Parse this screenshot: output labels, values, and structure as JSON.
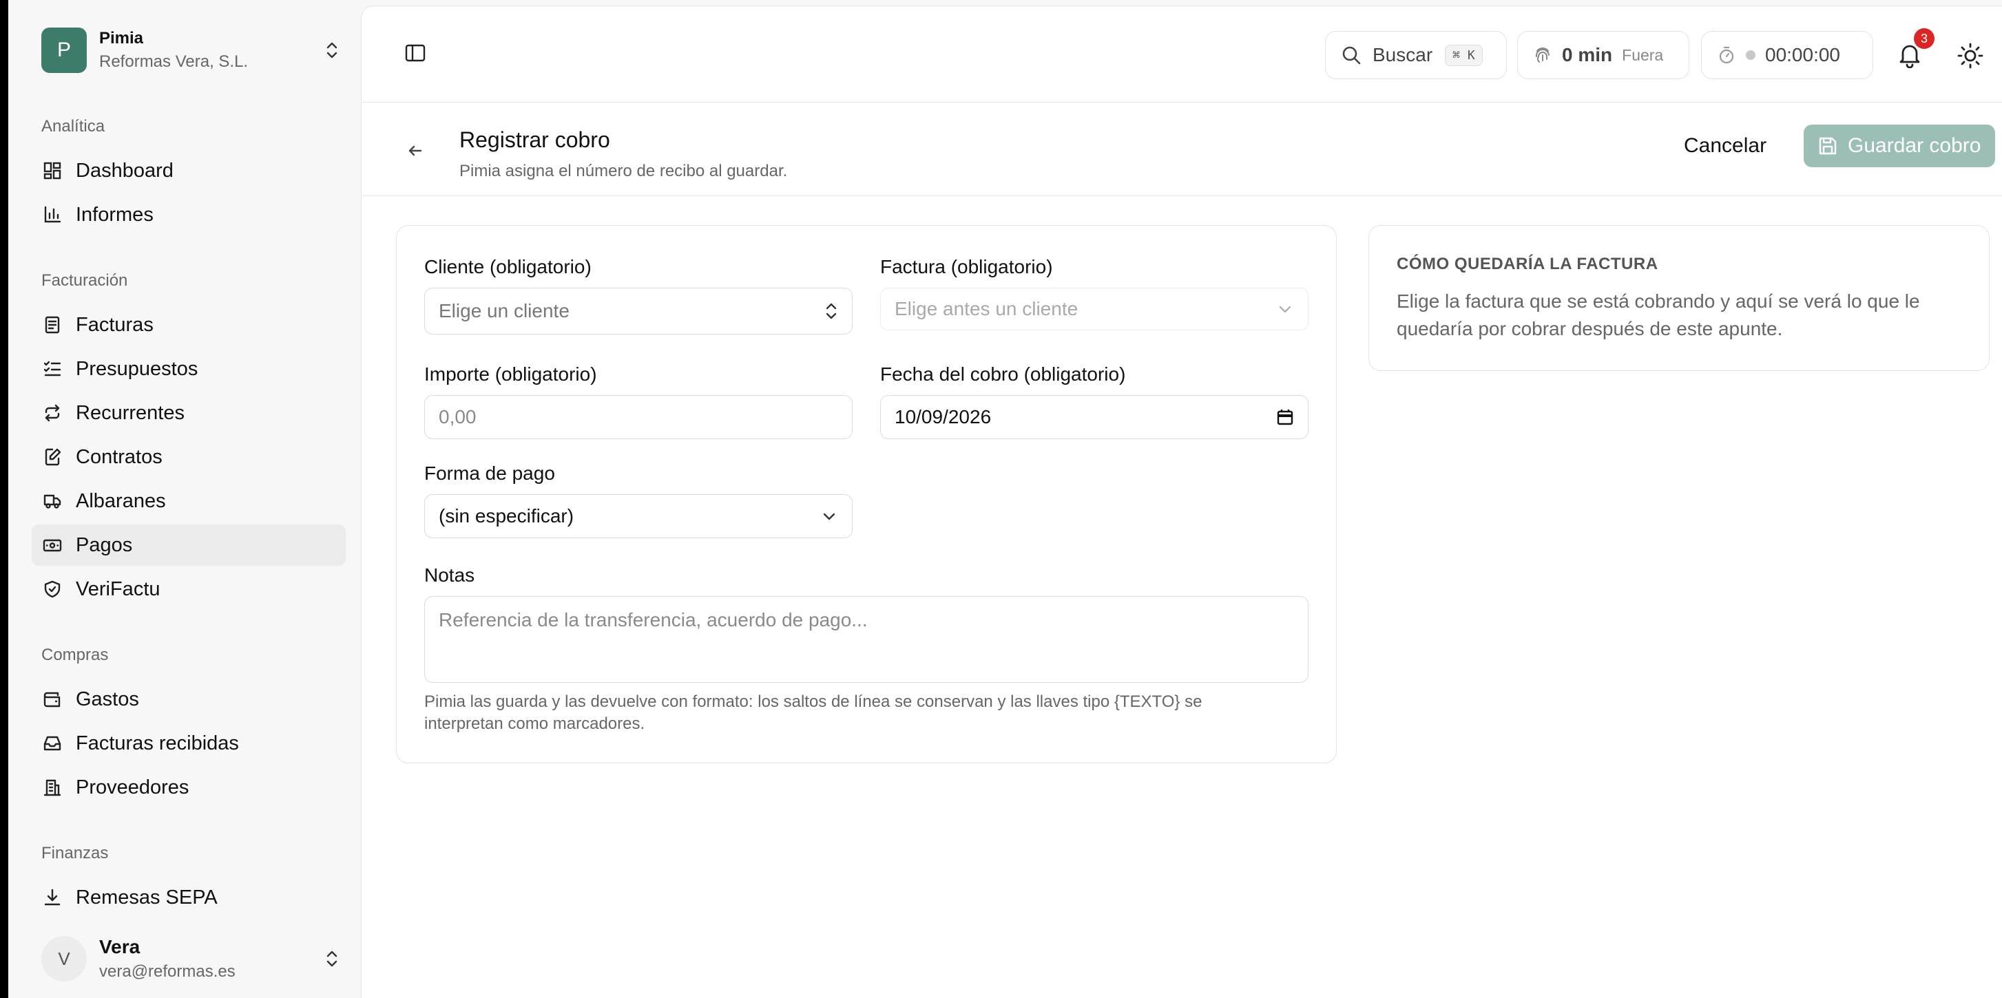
{
  "workspace": {
    "logo_letter": "P",
    "name": "Pimia",
    "company": "Reformas Vera, S.L."
  },
  "sidebar": {
    "sections": [
      {
        "label": "Analítica",
        "items": [
          {
            "label": "Dashboard",
            "icon": "dashboard-icon"
          },
          {
            "label": "Informes",
            "icon": "chart-icon"
          }
        ]
      },
      {
        "label": "Facturación",
        "items": [
          {
            "label": "Facturas",
            "icon": "invoice-icon"
          },
          {
            "label": "Presupuestos",
            "icon": "list-check-icon"
          },
          {
            "label": "Recurrentes",
            "icon": "repeat-icon"
          },
          {
            "label": "Contratos",
            "icon": "edit-doc-icon"
          },
          {
            "label": "Albaranes",
            "icon": "truck-icon"
          },
          {
            "label": "Pagos",
            "icon": "banknote-icon",
            "active": true
          },
          {
            "label": "VeriFactu",
            "icon": "shield-check-icon"
          }
        ]
      },
      {
        "label": "Compras",
        "items": [
          {
            "label": "Gastos",
            "icon": "wallet-icon"
          },
          {
            "label": "Facturas recibidas",
            "icon": "inbox-icon"
          },
          {
            "label": "Proveedores",
            "icon": "building-icon"
          }
        ]
      },
      {
        "label": "Finanzas",
        "items": [
          {
            "label": "Remesas SEPA",
            "icon": "download-icon"
          }
        ]
      }
    ]
  },
  "user": {
    "initial": "V",
    "name": "Vera",
    "email": "vera@reformas.es"
  },
  "topbar": {
    "search_label": "Buscar",
    "search_shortcut": "⌘ K",
    "time_value": "0 min",
    "time_status": "Fuera",
    "timer": "00:00:00",
    "notifications_count": "3"
  },
  "header": {
    "title": "Registrar cobro",
    "subtitle": "Pimia asigna el número de recibo al guardar.",
    "cancel_label": "Cancelar",
    "save_label": "Guardar cobro"
  },
  "form": {
    "cliente_label": "Cliente (obligatorio)",
    "cliente_placeholder": "Elige un cliente",
    "factura_label": "Factura (obligatorio)",
    "factura_placeholder": "Elige antes un cliente",
    "importe_label": "Importe (obligatorio)",
    "importe_placeholder": "0,00",
    "fecha_label": "Fecha del cobro (obligatorio)",
    "fecha_value": "10/09/2026",
    "forma_label": "Forma de pago",
    "forma_value": "(sin especificar)",
    "notas_label": "Notas",
    "notas_placeholder": "Referencia de la transferencia, acuerdo de pago...",
    "notas_help": "Pimia las guarda y las devuelve con formato: los saltos de línea se conservan y las llaves tipo {TEXTO} se interpretan como marcadores."
  },
  "preview": {
    "title": "CÓMO QUEDARÍA LA FACTURA",
    "text": "Elige la factura que se está cobrando y aquí se verá lo que le quedaría por cobrar después de este apunte."
  },
  "colors": {
    "brand": "#3d7b6a",
    "save_button": "#9bbfb4",
    "badge": "#dc2626"
  }
}
